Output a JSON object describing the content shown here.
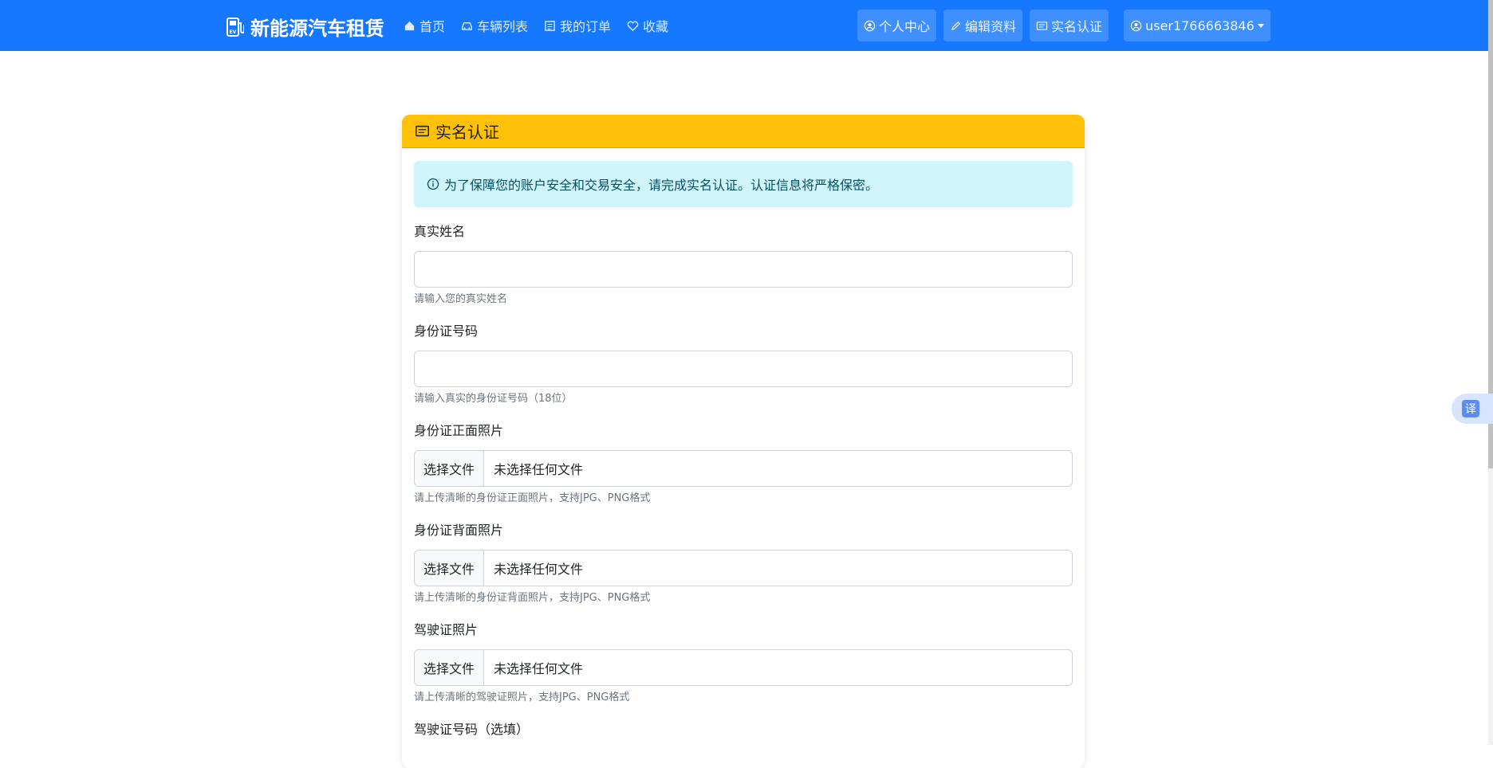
{
  "brand": {
    "name": "新能源汽车租赁",
    "logo_icon": "ev-charger-icon"
  },
  "nav": {
    "home": "首页",
    "vehicles": "车辆列表",
    "orders": "我的订单",
    "favorites": "收藏"
  },
  "nav_right": {
    "profile": "个人中心",
    "edit_profile": "编辑资料",
    "verify": "实名认证",
    "user": "user1766663846"
  },
  "card": {
    "title": "实名认证",
    "alert": "为了保障您的账户安全和交易安全，请完成实名认证。认证信息将严格保密。"
  },
  "form": {
    "real_name": {
      "label": "真实姓名",
      "value": "",
      "help": "请输入您的真实姓名"
    },
    "id_number": {
      "label": "身份证号码",
      "value": "",
      "help": "请输入真实的身份证号码（18位）"
    },
    "id_front": {
      "label": "身份证正面照片",
      "button": "选择文件",
      "status": "未选择任何文件",
      "help": "请上传清晰的身份证正面照片，支持JPG、PNG格式"
    },
    "id_back": {
      "label": "身份证背面照片",
      "button": "选择文件",
      "status": "未选择任何文件",
      "help": "请上传清晰的身份证背面照片，支持JPG、PNG格式"
    },
    "license": {
      "label": "驾驶证照片",
      "button": "选择文件",
      "status": "未选择任何文件",
      "help": "请上传清晰的驾驶证照片，支持JPG、PNG格式"
    },
    "license_number": {
      "label": "驾驶证号码（选填）"
    }
  },
  "translate": {
    "label": "译"
  },
  "colors": {
    "navbar": "#1677ff",
    "card_header": "#ffc107",
    "alert_bg": "#cff4fc"
  }
}
